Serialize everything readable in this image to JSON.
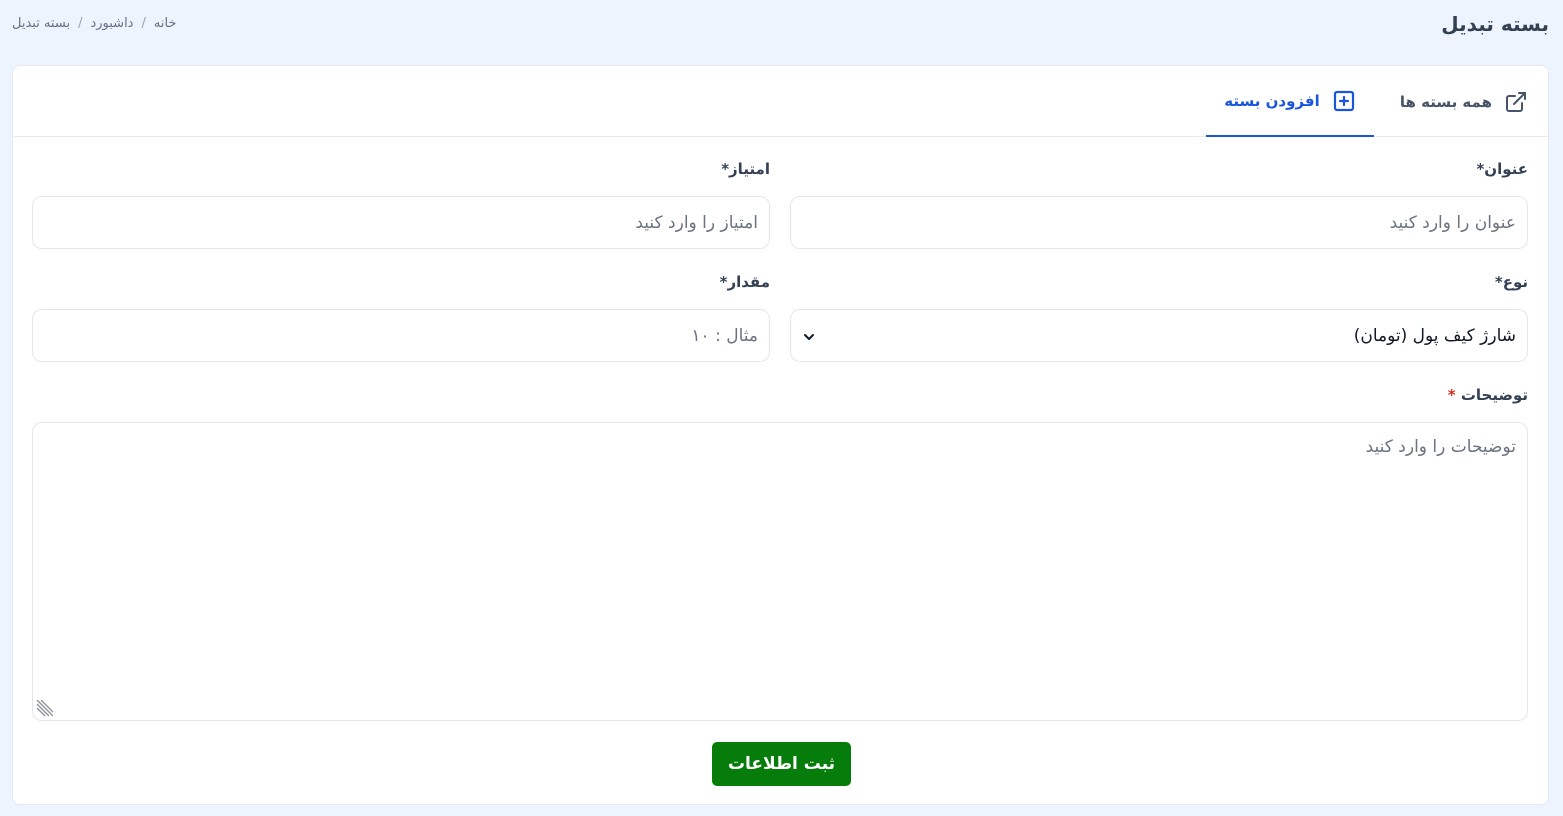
{
  "header": {
    "title": "بسته تبدیل",
    "breadcrumb": [
      "خانه",
      "داشبورد",
      "بسته تبدیل"
    ]
  },
  "tabs": [
    {
      "label": "همه بسته ها",
      "icon": "external-link-icon",
      "active": false
    },
    {
      "label": "افزودن بسته",
      "icon": "plus-square-icon",
      "active": true
    }
  ],
  "form": {
    "title_label": "عنوان*",
    "title_placeholder": "عنوان را وارد کنید",
    "score_label": "امتیاز*",
    "score_placeholder": "امتیاز را وارد کنید",
    "type_label": "نوع*",
    "type_value": "شارژ کیف پول (تومان)",
    "amount_label": "مقدار*",
    "amount_placeholder": "مثال : ۱۰",
    "description_label": "توضیحات",
    "description_required_mark": "*",
    "description_placeholder": "توضیحات را وارد کنید",
    "submit_label": "ثبت اطلاعات"
  },
  "colors": {
    "accent": "#1a56db",
    "submit": "#067d0a",
    "background": "#eef4fd",
    "required": "#d92d20"
  }
}
